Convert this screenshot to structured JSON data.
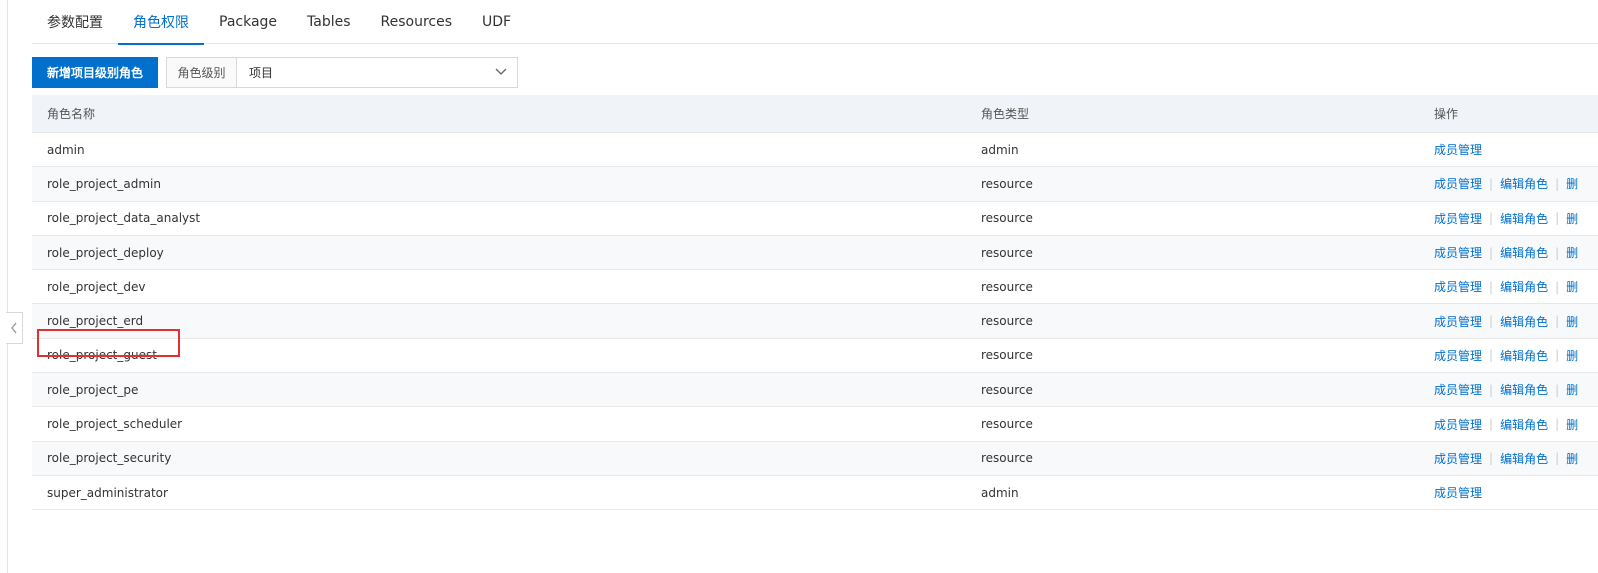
{
  "tabs": [
    {
      "label": "参数配置",
      "active": false
    },
    {
      "label": "角色权限",
      "active": true
    },
    {
      "label": "Package",
      "active": false
    },
    {
      "label": "Tables",
      "active": false
    },
    {
      "label": "Resources",
      "active": false
    },
    {
      "label": "UDF",
      "active": false
    }
  ],
  "toolbar": {
    "add_button": "新增项目级别角色",
    "level_label": "角色级别",
    "level_value": "项目"
  },
  "table": {
    "headers": {
      "name": "角色名称",
      "type": "角色类型",
      "ops": "操作"
    },
    "rows": [
      {
        "name": "admin",
        "type": "admin",
        "ops": [
          "成员管理"
        ]
      },
      {
        "name": "role_project_admin",
        "type": "resource",
        "ops": [
          "成员管理",
          "编辑角色",
          "删"
        ]
      },
      {
        "name": "role_project_data_analyst",
        "type": "resource",
        "ops": [
          "成员管理",
          "编辑角色",
          "删"
        ]
      },
      {
        "name": "role_project_deploy",
        "type": "resource",
        "ops": [
          "成员管理",
          "编辑角色",
          "删"
        ]
      },
      {
        "name": "role_project_dev",
        "type": "resource",
        "ops": [
          "成员管理",
          "编辑角色",
          "删"
        ]
      },
      {
        "name": "role_project_erd",
        "type": "resource",
        "ops": [
          "成员管理",
          "编辑角色",
          "删"
        ]
      },
      {
        "name": "role_project_guest",
        "type": "resource",
        "ops": [
          "成员管理",
          "编辑角色",
          "删"
        ],
        "highlighted": true
      },
      {
        "name": "role_project_pe",
        "type": "resource",
        "ops": [
          "成员管理",
          "编辑角色",
          "删"
        ]
      },
      {
        "name": "role_project_scheduler",
        "type": "resource",
        "ops": [
          "成员管理",
          "编辑角色",
          "删"
        ]
      },
      {
        "name": "role_project_security",
        "type": "resource",
        "ops": [
          "成员管理",
          "编辑角色",
          "删"
        ]
      },
      {
        "name": "super_administrator",
        "type": "admin",
        "ops": [
          "成员管理"
        ]
      }
    ]
  },
  "colors": {
    "accent": "#0070cc",
    "highlight": "#e03030"
  }
}
